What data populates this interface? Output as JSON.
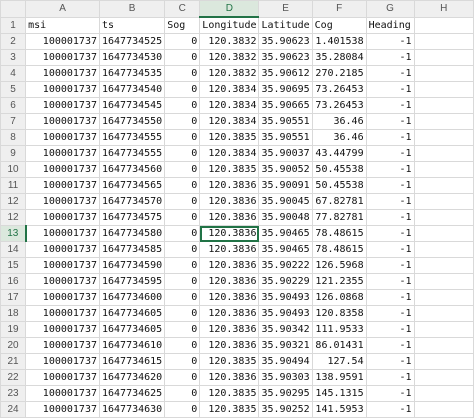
{
  "columns": [
    "",
    "A",
    "B",
    "C",
    "D",
    "E",
    "F",
    "G",
    "H"
  ],
  "selected_column": "D",
  "selected_row": "13",
  "header_row": {
    "row": "1",
    "cells": [
      "msi",
      "ts",
      "Sog",
      "Longitude",
      "Latitude",
      "Cog",
      "Heading",
      ""
    ]
  },
  "rows": [
    {
      "row": "2",
      "cells": [
        "100001737",
        "1647734525",
        "0",
        "120.3832",
        "35.90623",
        "1.401538",
        "-1",
        ""
      ]
    },
    {
      "row": "3",
      "cells": [
        "100001737",
        "1647734530",
        "0",
        "120.3832",
        "35.90623",
        "35.28084",
        "-1",
        ""
      ]
    },
    {
      "row": "4",
      "cells": [
        "100001737",
        "1647734535",
        "0",
        "120.3832",
        "35.90612",
        "270.2185",
        "-1",
        ""
      ]
    },
    {
      "row": "5",
      "cells": [
        "100001737",
        "1647734540",
        "0",
        "120.3834",
        "35.90695",
        "73.26453",
        "-1",
        ""
      ]
    },
    {
      "row": "6",
      "cells": [
        "100001737",
        "1647734545",
        "0",
        "120.3834",
        "35.90665",
        "73.26453",
        "-1",
        ""
      ]
    },
    {
      "row": "7",
      "cells": [
        "100001737",
        "1647734550",
        "0",
        "120.3834",
        "35.90551",
        "36.46",
        "-1",
        ""
      ]
    },
    {
      "row": "8",
      "cells": [
        "100001737",
        "1647734555",
        "0",
        "120.3835",
        "35.90551",
        "36.46",
        "-1",
        ""
      ]
    },
    {
      "row": "9",
      "cells": [
        "100001737",
        "1647734555",
        "0",
        "120.3834",
        "35.90037",
        "43.44799",
        "-1",
        ""
      ]
    },
    {
      "row": "10",
      "cells": [
        "100001737",
        "1647734560",
        "0",
        "120.3835",
        "35.90052",
        "50.45538",
        "-1",
        ""
      ]
    },
    {
      "row": "11",
      "cells": [
        "100001737",
        "1647734565",
        "0",
        "120.3836",
        "35.90091",
        "50.45538",
        "-1",
        ""
      ]
    },
    {
      "row": "12",
      "cells": [
        "100001737",
        "1647734570",
        "0",
        "120.3836",
        "35.90045",
        "67.82781",
        "-1",
        ""
      ]
    },
    {
      "row": "12",
      "cells": [
        "100001737",
        "1647734575",
        "0",
        "120.3836",
        "35.90048",
        "77.82781",
        "-1",
        ""
      ]
    },
    {
      "row": "13",
      "cells": [
        "100001737",
        "1647734580",
        "0",
        "120.3836",
        "35.90465",
        "78.48615",
        "-1",
        ""
      ]
    },
    {
      "row": "14",
      "cells": [
        "100001737",
        "1647734585",
        "0",
        "120.3836",
        "35.90465",
        "78.48615",
        "-1",
        ""
      ]
    },
    {
      "row": "15",
      "cells": [
        "100001737",
        "1647734590",
        "0",
        "120.3836",
        "35.90222",
        "126.5968",
        "-1",
        ""
      ]
    },
    {
      "row": "16",
      "cells": [
        "100001737",
        "1647734595",
        "0",
        "120.3836",
        "35.90229",
        "121.2355",
        "-1",
        ""
      ]
    },
    {
      "row": "17",
      "cells": [
        "100001737",
        "1647734600",
        "0",
        "120.3836",
        "35.90493",
        "126.0868",
        "-1",
        ""
      ]
    },
    {
      "row": "18",
      "cells": [
        "100001737",
        "1647734605",
        "0",
        "120.3836",
        "35.90493",
        "120.8358",
        "-1",
        ""
      ]
    },
    {
      "row": "19",
      "cells": [
        "100001737",
        "1647734605",
        "0",
        "120.3836",
        "35.90342",
        "111.9533",
        "-1",
        ""
      ]
    },
    {
      "row": "20",
      "cells": [
        "100001737",
        "1647734610",
        "0",
        "120.3836",
        "35.90321",
        "86.01431",
        "-1",
        ""
      ]
    },
    {
      "row": "21",
      "cells": [
        "100001737",
        "1647734615",
        "0",
        "120.3835",
        "35.90494",
        "127.54",
        "-1",
        ""
      ]
    },
    {
      "row": "22",
      "cells": [
        "100001737",
        "1647734620",
        "0",
        "120.3836",
        "35.90303",
        "138.9591",
        "-1",
        ""
      ]
    },
    {
      "row": "23",
      "cells": [
        "100001737",
        "1647734625",
        "0",
        "120.3835",
        "35.90295",
        "145.1315",
        "-1",
        ""
      ]
    },
    {
      "row": "24",
      "cells": [
        "100001737",
        "1647734630",
        "0",
        "120.3835",
        "35.90252",
        "141.5953",
        "-1",
        ""
      ]
    }
  ]
}
